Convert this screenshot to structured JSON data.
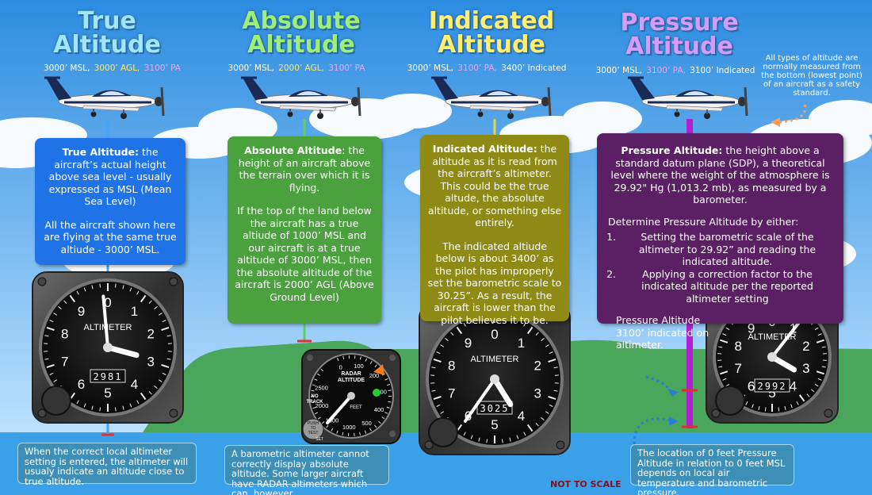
{
  "columns": [
    {
      "id": "true",
      "title_line1": "True",
      "title_line2": "Altitude",
      "title_color": "#9fe6ff",
      "sub": [
        {
          "text": "3000’ MSL,",
          "color": "#ffffff"
        },
        {
          "text": "3000’ AGL,",
          "color": "#ffe978"
        },
        {
          "text": "3100’ PA",
          "color": "#e6a8ff"
        }
      ],
      "box_color": "#1f73e6",
      "box_title": "True Altitude:",
      "box_p1": " the aircraft’s actual height above sea level - usually expressed as MSL (Mean Sea Level)",
      "box_p2": "All the aircraft shown here are flying at the same true altiude - 3000’ MSL.",
      "caption": "When the correct local altimeter setting is entered, the altimeter will usualy indicate an altitude close to true altitude.",
      "gauge_label": "ALTIMETER",
      "gauge_readout": "2981",
      "gauge_numbers": [
        "0",
        "1",
        "2",
        "3",
        "4",
        "5",
        "6",
        "7",
        "8",
        "9"
      ]
    },
    {
      "id": "absolute",
      "title_line1": "Absolute",
      "title_line2": "Altitude",
      "title_color": "#9cf07a",
      "sub": [
        {
          "text": "3000’ MSL,",
          "color": "#ffffff"
        },
        {
          "text": "2000’ AGL,",
          "color": "#ffe978"
        },
        {
          "text": "3100’ PA",
          "color": "#e6a8ff"
        }
      ],
      "box_color": "#4aa13d",
      "box_title": "Absolute Altitude",
      "box_p1": ": the height of an aircraft above the terrain over which it is flying.",
      "box_p2": "If the top of the land below the aircraft has a true altiude of 1000’ MSL and our aircraft is at a true altitude of 3000’ MSL, then the absolute altitude of the aircraft is 2000’ AGL (Above Ground Level)",
      "caption": "A barometric altimeter cannot correctly display absolute altitude. Some larger aircraft have RADAR altimeters which can, however.",
      "radar": {
        "label1": "RADAR",
        "label2": "ALTITUDE",
        "feet": "FEET",
        "no_track1": "NO",
        "no_track2": "TRACK",
        "push1": "PUSH",
        "push2": "TO",
        "push3": "TEST",
        "set": "SET",
        "scale": [
          "0",
          "100",
          "200",
          "300",
          "400",
          "500",
          "1000",
          "1500",
          "2000",
          "2500"
        ]
      }
    },
    {
      "id": "indicated",
      "title_line1": "Indicated",
      "title_line2": "Altitude",
      "title_color": "#ffef70",
      "sub": [
        {
          "text": "3000’ MSL,",
          "color": "#ffffff"
        },
        {
          "text": "3100’ PA,",
          "color": "#e6a8ff"
        },
        {
          "text": "3400’ Indicated",
          "color": "#ffffff"
        }
      ],
      "box_color": "#8f8a16",
      "box_title": "Indicated Altitude:",
      "box_p1": " the altitude as it is read from the aircraft’s altimeter. This could be the true altude, the absolute altitude, or something else entirely.",
      "box_p2": "The indicated altiude below is about 3400’ as the pilot has improperly set the barometric scale to 30.25”.  As a result, the aircraft is lower than the pilot believes it to be.",
      "gauge_label": "ALTIMETER",
      "gauge_readout": "3025",
      "gauge_numbers": [
        "0",
        "1",
        "2",
        "3",
        "4",
        "5",
        "6",
        "7",
        "8",
        "9"
      ]
    },
    {
      "id": "pressure",
      "title_line1": "Pressure",
      "title_line2": "Altitude",
      "title_color": "#d79bff",
      "sub": [
        {
          "text": "3000’ MSL,",
          "color": "#ffffff"
        },
        {
          "text": "3100’ PA,",
          "color": "#e6a8ff"
        },
        {
          "text": "3100’ Indicated",
          "color": "#ffffff"
        }
      ],
      "box_color": "#5b1f63",
      "box_title": "Pressure Altitude:",
      "box_p1": " the height above a standard datum plane (SDP), a theoretical level where the weight of the atmosphere  is 29.92\" Hg (1,013.2 mb), as measured by a barometer.",
      "box_p2": "Determine Pressure Altitude by either:",
      "list": [
        "Setting the barometric scale of the altimeter to 29.92” and reading the indicated altitude.",
        "Applying a correction factor to the indicated altitude per the reported altimeter setting"
      ],
      "box_p3": "Pressure Altitude 3100’ indicated on altimeter.",
      "caption": "The location of 0 feet Pressure Altitude in relation to 0 feet MSL depends on local air temperature and barometric pressure.",
      "gauge_label": "ALTIMETER",
      "gauge_readout": "2992",
      "gauge_numbers": [
        "0",
        "1",
        "2",
        "3",
        "4",
        "5",
        "6",
        "7",
        "8",
        "9"
      ]
    }
  ],
  "side_note": "All types of altitude are normally measured from the bottom (lowest point) of an aircraft as a safety standard.",
  "not_to_scale": "NOT TO SCALE",
  "colors": {
    "sky_top": "#2c8ce0",
    "sky_bottom": "#bfe3ff",
    "sea": "#3aa0e8",
    "land": "#4aa65a",
    "pressure_pole": "#b020d0",
    "marker_red": "#e03030"
  }
}
